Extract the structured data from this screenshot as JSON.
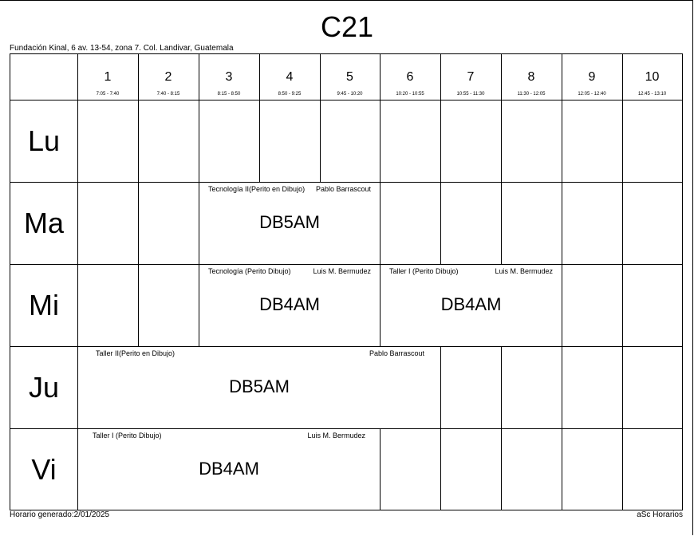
{
  "title": "C21",
  "school": "Fundación Kinal, 6 av. 13-54, zona 7. Col. Landivar, Guatemala",
  "footer": {
    "generated": "Horario generado:2/01/2025",
    "brand": "aSc Horarios"
  },
  "periods": [
    {
      "num": "1",
      "time": "7:05 - 7:40"
    },
    {
      "num": "2",
      "time": "7:40 - 8:15"
    },
    {
      "num": "3",
      "time": "8:15 - 8:50"
    },
    {
      "num": "4",
      "time": "8:50 - 9:25"
    },
    {
      "num": "5",
      "time": "9:45 - 10:20"
    },
    {
      "num": "6",
      "time": "10:20 - 10:55"
    },
    {
      "num": "7",
      "time": "10:55 - 11:30"
    },
    {
      "num": "8",
      "time": "11:30 - 12:05"
    },
    {
      "num": "9",
      "time": "12:05 - 12:40"
    },
    {
      "num": "10",
      "time": "12:45 - 13:10"
    }
  ],
  "days": [
    "Lu",
    "Ma",
    "Mi",
    "Ju",
    "Vi"
  ],
  "lessons": [
    {
      "subject": "Tecnología II(Perito en Dibujo)",
      "teacher": "Pablo Barrascout",
      "group": "DB5AM"
    },
    {
      "subject": "Tecnología (Perito Dibujo)",
      "teacher": "Luis M. Bermudez",
      "group": "DB4AM"
    },
    {
      "subject": "Taller I (Perito Dibujo)",
      "teacher": "Luis M. Bermudez",
      "group": "DB4AM"
    },
    {
      "subject": "Taller II(Perito en Dibujo)",
      "teacher": "Pablo Barrascout",
      "group": "DB5AM"
    },
    {
      "subject": "Taller I (Perito Dibujo)",
      "teacher": "Luis M. Bermudez",
      "group": "DB4AM"
    }
  ]
}
